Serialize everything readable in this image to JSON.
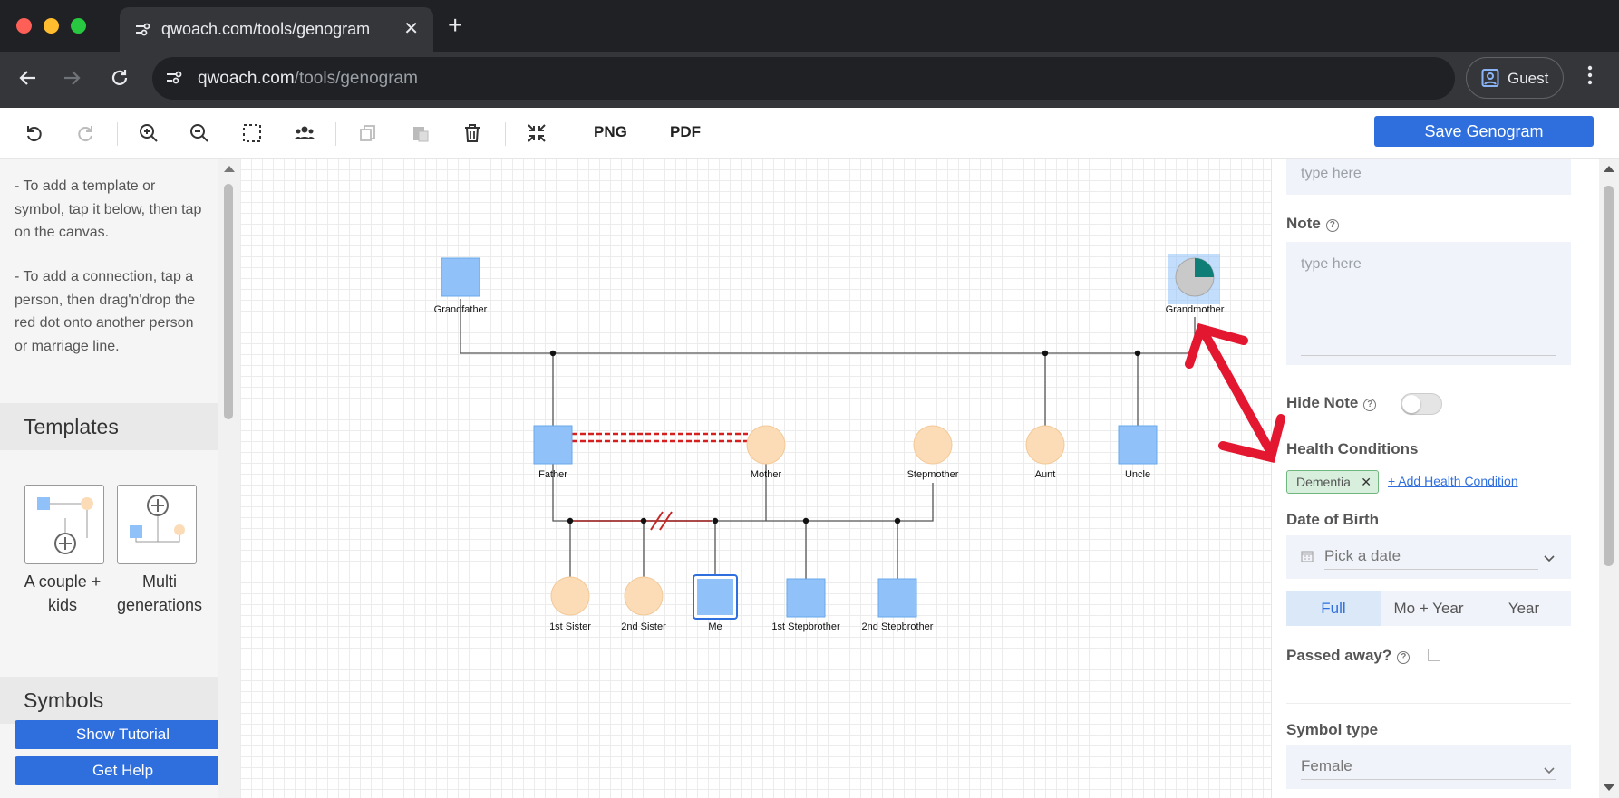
{
  "browser": {
    "tab_title": "qwoach.com/tools/genogram",
    "url_host": "qwoach.com",
    "url_path": "/tools/genogram",
    "profile_label": "Guest"
  },
  "toolbar": {
    "png_label": "PNG",
    "pdf_label": "PDF",
    "save_label": "Save Genogram"
  },
  "left_panel": {
    "hint_template": "- To add a template or symbol, tap it below, then tap on the canvas.",
    "hint_connection": "- To add a connection, tap a person, then drag'n'drop the red dot onto another person or marriage line.",
    "templates_heading": "Templates",
    "templates": [
      {
        "label_line1": "A couple +",
        "label_line2": "kids"
      },
      {
        "label_line1": "Multi",
        "label_line2": "generations"
      }
    ],
    "symbols_heading": "Symbols",
    "show_tutorial": "Show Tutorial",
    "get_help": "Get Help"
  },
  "genogram": {
    "people": {
      "grandfather": "Grandfather",
      "grandmother": "Grandmother",
      "father": "Father",
      "mother": "Mother",
      "stepmother": "Stepmother",
      "aunt": "Aunt",
      "uncle": "Uncle",
      "sister1": "1st Sister",
      "sister2": "2nd Sister",
      "me": "Me",
      "stepbrother1": "1st Stepbrother",
      "stepbrother2": "2nd Stepbrother"
    },
    "colors": {
      "male": "#90c2f9",
      "female": "#fbdcb7",
      "line": "#555555",
      "conflict": "#d62020",
      "annotation_arrow": "#e3172f"
    }
  },
  "right_panel": {
    "top_placeholder": "type here",
    "note_label": "Note",
    "note_placeholder": "type here",
    "hide_note_label": "Hide Note",
    "health_label": "Health Conditions",
    "health_chip": "Dementia",
    "add_health": "+ Add Health Condition",
    "dob_label": "Date of Birth",
    "dob_placeholder": "Pick a date",
    "date_formats": [
      "Full",
      "Mo + Year",
      "Year"
    ],
    "passed_label": "Passed away?",
    "symbol_type_label": "Symbol type",
    "symbol_type_value": "Female"
  }
}
